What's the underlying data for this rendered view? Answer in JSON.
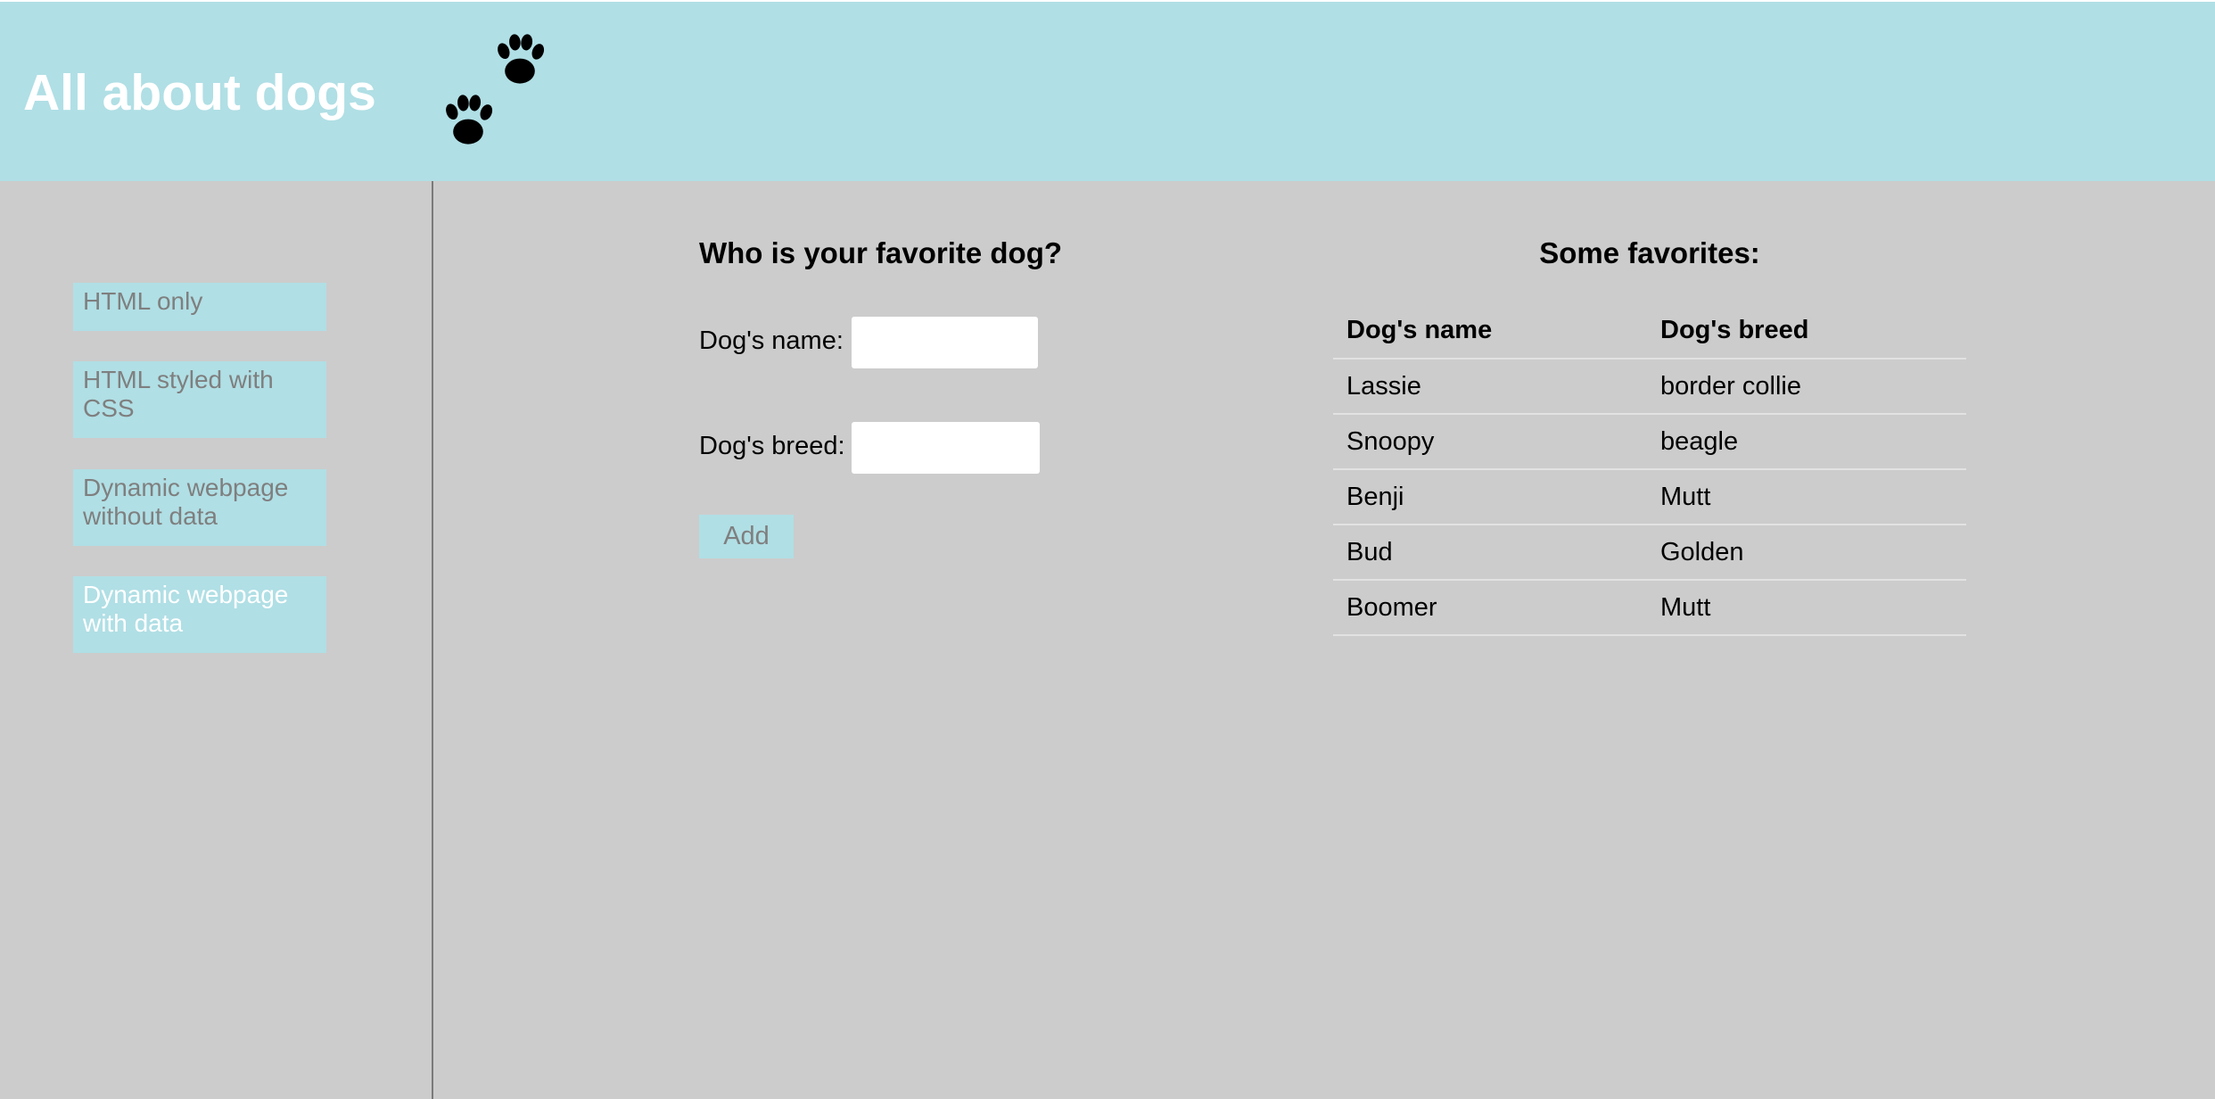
{
  "header": {
    "title": "All about dogs",
    "paw_icon": "paw-print-icon",
    "background_color": "#b0dfe5"
  },
  "sidebar": {
    "items": [
      {
        "label": "HTML only",
        "active": false
      },
      {
        "label": "HTML styled with CSS",
        "active": false
      },
      {
        "label": "Dynamic webpage without data",
        "active": false
      },
      {
        "label": "Dynamic webpage with data",
        "active": true
      }
    ]
  },
  "form": {
    "title": "Who is your favorite dog?",
    "name_label": "Dog's name:",
    "name_value": "",
    "breed_label": "Dog's breed:",
    "breed_value": "",
    "add_label": "Add"
  },
  "favorites": {
    "title": "Some favorites:",
    "columns": [
      "Dog's name",
      "Dog's breed"
    ],
    "rows": [
      [
        "Lassie",
        "border collie"
      ],
      [
        "Snoopy",
        "beagle"
      ],
      [
        "Benji",
        "Mutt"
      ],
      [
        "Bud",
        "Golden"
      ],
      [
        "Boomer",
        "Mutt"
      ]
    ]
  },
  "colors": {
    "accent": "#b0dfe5",
    "page_background": "#cccccc",
    "muted_text": "#7f7f7f"
  }
}
